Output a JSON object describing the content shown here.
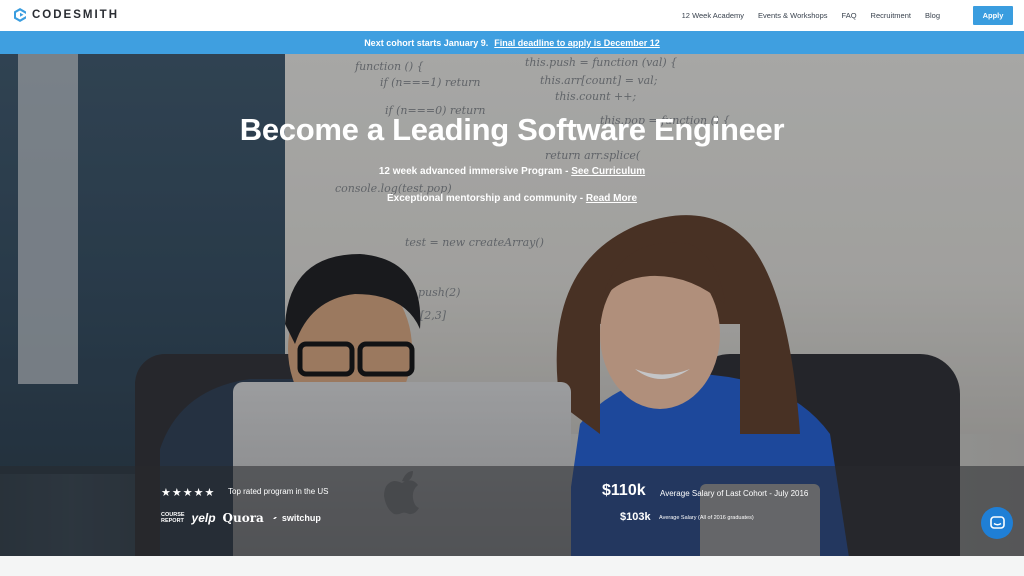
{
  "brand": {
    "name": "CODESMITH"
  },
  "nav": {
    "links": [
      "12 Week Academy",
      "Events & Workshops",
      "FAQ",
      "Recruitment",
      "Blog"
    ],
    "apply_label": "Apply"
  },
  "announcement": {
    "lead": "Next cohort starts January 9.",
    "link": "Final deadline to apply is December 12"
  },
  "hero": {
    "title": "Become a Leading Software Engineer",
    "line1_text": "12 week advanced immersive Program - ",
    "line1_link": "See Curriculum",
    "line2_text": "Exceptional mentorship and community - ",
    "line2_link": "Read More"
  },
  "stats": {
    "stars": "★★★★★",
    "rating": 5,
    "top_rated": "Top rated program in the US",
    "badges": {
      "course_report_line1": "COURSE",
      "course_report_line2": "REPORT",
      "yelp": "yelp",
      "quora": "Quora",
      "switchup": "switchup"
    },
    "salary_main_value": "$110k",
    "salary_main_label": "Average Salary of Last Cohort - July 2016",
    "salary_secondary_value": "$103k",
    "salary_secondary_label": "Average Salary (All of 2016 graduates)"
  },
  "colors": {
    "accent": "#3f9fe0",
    "apply_button": "#3a9ddf",
    "chat_button": "#1f7fd6"
  },
  "icons": {
    "logo": "codesmith-logo-icon",
    "chat": "chat-icon",
    "switchup": "switchup-icon"
  }
}
